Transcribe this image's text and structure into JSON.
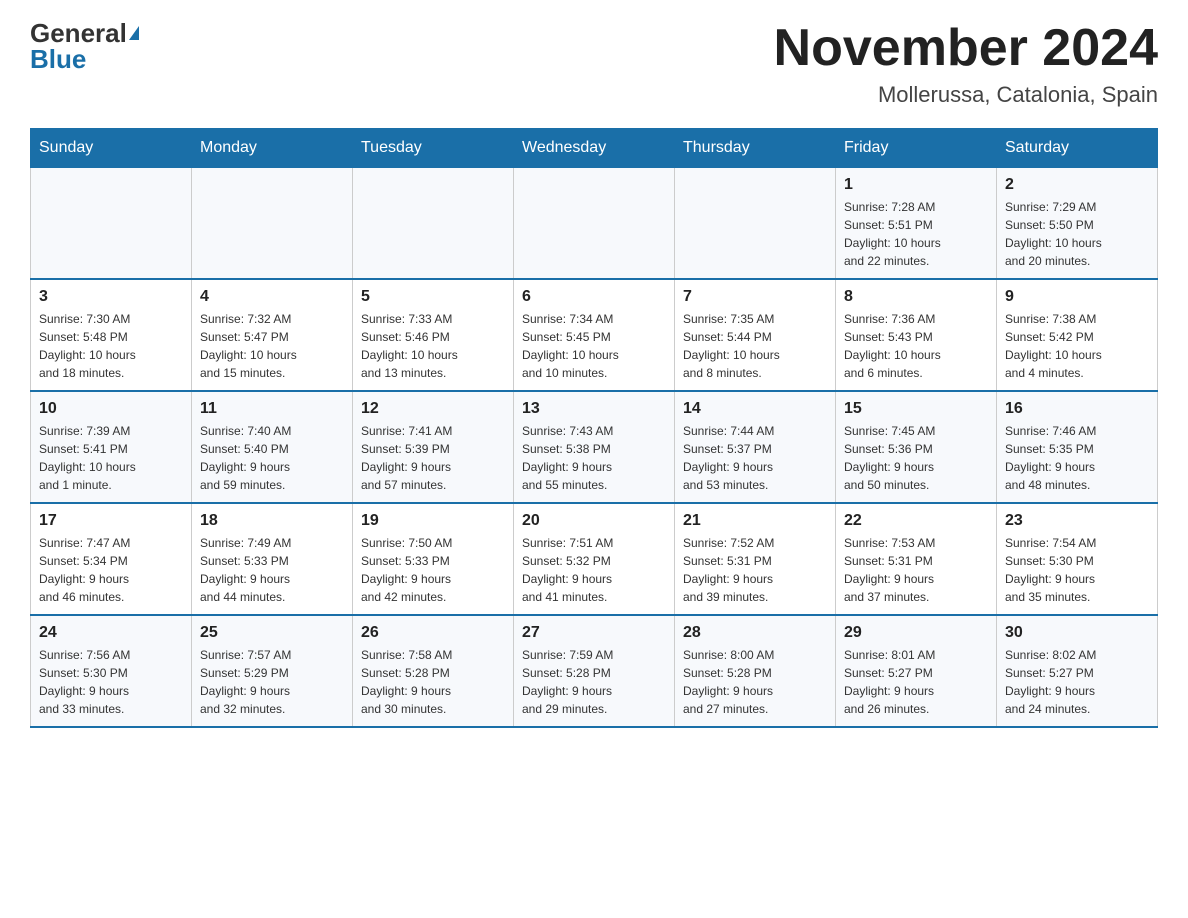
{
  "logo": {
    "general": "General",
    "blue": "Blue"
  },
  "title": "November 2024",
  "location": "Mollerussa, Catalonia, Spain",
  "days_of_week": [
    "Sunday",
    "Monday",
    "Tuesday",
    "Wednesday",
    "Thursday",
    "Friday",
    "Saturday"
  ],
  "weeks": [
    [
      {
        "day": "",
        "info": ""
      },
      {
        "day": "",
        "info": ""
      },
      {
        "day": "",
        "info": ""
      },
      {
        "day": "",
        "info": ""
      },
      {
        "day": "",
        "info": ""
      },
      {
        "day": "1",
        "info": "Sunrise: 7:28 AM\nSunset: 5:51 PM\nDaylight: 10 hours\nand 22 minutes."
      },
      {
        "day": "2",
        "info": "Sunrise: 7:29 AM\nSunset: 5:50 PM\nDaylight: 10 hours\nand 20 minutes."
      }
    ],
    [
      {
        "day": "3",
        "info": "Sunrise: 7:30 AM\nSunset: 5:48 PM\nDaylight: 10 hours\nand 18 minutes."
      },
      {
        "day": "4",
        "info": "Sunrise: 7:32 AM\nSunset: 5:47 PM\nDaylight: 10 hours\nand 15 minutes."
      },
      {
        "day": "5",
        "info": "Sunrise: 7:33 AM\nSunset: 5:46 PM\nDaylight: 10 hours\nand 13 minutes."
      },
      {
        "day": "6",
        "info": "Sunrise: 7:34 AM\nSunset: 5:45 PM\nDaylight: 10 hours\nand 10 minutes."
      },
      {
        "day": "7",
        "info": "Sunrise: 7:35 AM\nSunset: 5:44 PM\nDaylight: 10 hours\nand 8 minutes."
      },
      {
        "day": "8",
        "info": "Sunrise: 7:36 AM\nSunset: 5:43 PM\nDaylight: 10 hours\nand 6 minutes."
      },
      {
        "day": "9",
        "info": "Sunrise: 7:38 AM\nSunset: 5:42 PM\nDaylight: 10 hours\nand 4 minutes."
      }
    ],
    [
      {
        "day": "10",
        "info": "Sunrise: 7:39 AM\nSunset: 5:41 PM\nDaylight: 10 hours\nand 1 minute."
      },
      {
        "day": "11",
        "info": "Sunrise: 7:40 AM\nSunset: 5:40 PM\nDaylight: 9 hours\nand 59 minutes."
      },
      {
        "day": "12",
        "info": "Sunrise: 7:41 AM\nSunset: 5:39 PM\nDaylight: 9 hours\nand 57 minutes."
      },
      {
        "day": "13",
        "info": "Sunrise: 7:43 AM\nSunset: 5:38 PM\nDaylight: 9 hours\nand 55 minutes."
      },
      {
        "day": "14",
        "info": "Sunrise: 7:44 AM\nSunset: 5:37 PM\nDaylight: 9 hours\nand 53 minutes."
      },
      {
        "day": "15",
        "info": "Sunrise: 7:45 AM\nSunset: 5:36 PM\nDaylight: 9 hours\nand 50 minutes."
      },
      {
        "day": "16",
        "info": "Sunrise: 7:46 AM\nSunset: 5:35 PM\nDaylight: 9 hours\nand 48 minutes."
      }
    ],
    [
      {
        "day": "17",
        "info": "Sunrise: 7:47 AM\nSunset: 5:34 PM\nDaylight: 9 hours\nand 46 minutes."
      },
      {
        "day": "18",
        "info": "Sunrise: 7:49 AM\nSunset: 5:33 PM\nDaylight: 9 hours\nand 44 minutes."
      },
      {
        "day": "19",
        "info": "Sunrise: 7:50 AM\nSunset: 5:33 PM\nDaylight: 9 hours\nand 42 minutes."
      },
      {
        "day": "20",
        "info": "Sunrise: 7:51 AM\nSunset: 5:32 PM\nDaylight: 9 hours\nand 41 minutes."
      },
      {
        "day": "21",
        "info": "Sunrise: 7:52 AM\nSunset: 5:31 PM\nDaylight: 9 hours\nand 39 minutes."
      },
      {
        "day": "22",
        "info": "Sunrise: 7:53 AM\nSunset: 5:31 PM\nDaylight: 9 hours\nand 37 minutes."
      },
      {
        "day": "23",
        "info": "Sunrise: 7:54 AM\nSunset: 5:30 PM\nDaylight: 9 hours\nand 35 minutes."
      }
    ],
    [
      {
        "day": "24",
        "info": "Sunrise: 7:56 AM\nSunset: 5:30 PM\nDaylight: 9 hours\nand 33 minutes."
      },
      {
        "day": "25",
        "info": "Sunrise: 7:57 AM\nSunset: 5:29 PM\nDaylight: 9 hours\nand 32 minutes."
      },
      {
        "day": "26",
        "info": "Sunrise: 7:58 AM\nSunset: 5:28 PM\nDaylight: 9 hours\nand 30 minutes."
      },
      {
        "day": "27",
        "info": "Sunrise: 7:59 AM\nSunset: 5:28 PM\nDaylight: 9 hours\nand 29 minutes."
      },
      {
        "day": "28",
        "info": "Sunrise: 8:00 AM\nSunset: 5:28 PM\nDaylight: 9 hours\nand 27 minutes."
      },
      {
        "day": "29",
        "info": "Sunrise: 8:01 AM\nSunset: 5:27 PM\nDaylight: 9 hours\nand 26 minutes."
      },
      {
        "day": "30",
        "info": "Sunrise: 8:02 AM\nSunset: 5:27 PM\nDaylight: 9 hours\nand 24 minutes."
      }
    ]
  ]
}
